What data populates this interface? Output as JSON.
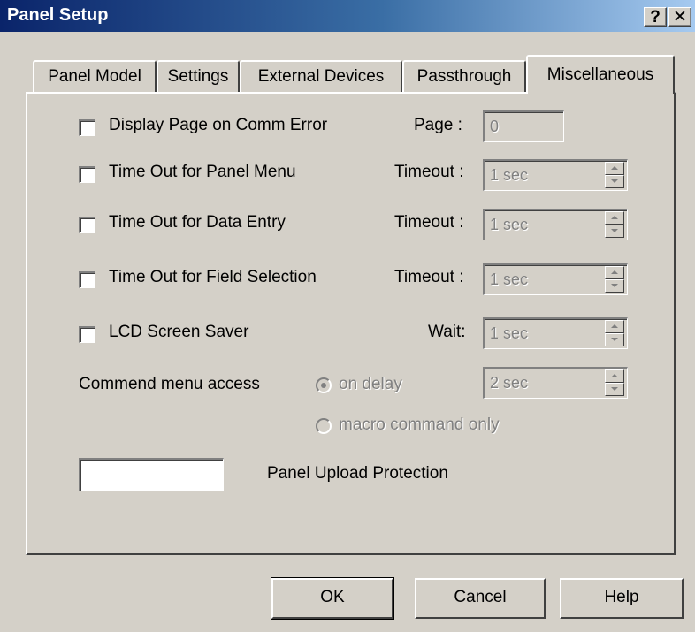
{
  "window": {
    "title": "Panel Setup",
    "help_glyph": "?",
    "close_glyph": "✕"
  },
  "tabs": [
    {
      "label": "Panel Model",
      "active": false
    },
    {
      "label": "Settings",
      "active": false
    },
    {
      "label": "External Devices",
      "active": false
    },
    {
      "label": "Passthrough",
      "active": false
    },
    {
      "label": "Miscellaneous",
      "active": true
    }
  ],
  "options": {
    "display_page": {
      "label": "Display Page on Comm Error",
      "field_label": "Page :",
      "value": "0",
      "checked": false
    },
    "timeout_panel_menu": {
      "label": "Time Out for Panel Menu",
      "field_label": "Timeout :",
      "value": "1 sec",
      "checked": false
    },
    "timeout_data_entry": {
      "label": "Time Out for Data Entry",
      "field_label": "Timeout :",
      "value": "1 sec",
      "checked": false
    },
    "timeout_field_selection": {
      "label": "Time Out for Field Selection",
      "field_label": "Timeout :",
      "value": "1 sec",
      "checked": false
    },
    "lcd_screen_saver": {
      "label": "LCD Screen Saver",
      "field_label": "Wait:",
      "value": "1 sec",
      "checked": false
    }
  },
  "command_menu": {
    "label": "Commend menu access",
    "on_delay_label": "on delay",
    "macro_label": "macro command only",
    "delay_value": "2 sec",
    "selected": "on delay"
  },
  "upload_protection": {
    "label": "Panel Upload Protection",
    "value": ""
  },
  "buttons": {
    "ok": "OK",
    "cancel": "Cancel",
    "help": "Help"
  },
  "colors": {
    "dialog_bg": "#d4d0c8",
    "title_start": "#0a246a",
    "title_end": "#a6caf0",
    "disabled_text": "#808080"
  }
}
